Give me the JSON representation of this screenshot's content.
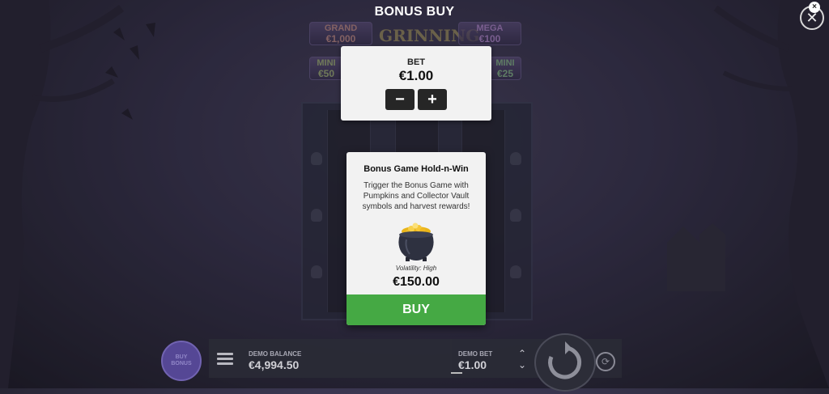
{
  "title": "BONUS BUY",
  "close": {
    "glyph": "✕",
    "badge": "×"
  },
  "game_background": {
    "jackpots": [
      {
        "name": "GRAND",
        "value": "€1,000"
      },
      {
        "name": "MEGA",
        "value": "€100"
      },
      {
        "name": "MINI",
        "value": "€50"
      },
      {
        "name": "MINI",
        "value": "€25"
      }
    ],
    "logo": "GRINNING"
  },
  "bet_panel": {
    "label": "BET",
    "value": "€1.00",
    "minus": "−",
    "plus": "+"
  },
  "bonus_card": {
    "title": "Bonus Game Hold-n-Win",
    "description": "Trigger the Bonus Game with Pumpkins and Collector Vault symbols and harvest rewards!",
    "volatility": "Volatility: High",
    "price": "€150.00",
    "buy_label": "BUY",
    "image_icon": "pot-of-gold-icon"
  },
  "bottom_bar": {
    "buy_bonus_label_1": "BUY",
    "buy_bonus_label_2": "BONUS",
    "balance_label": "DEMO BALANCE",
    "balance_value": "€4,994.50",
    "bet_label": "DEMO BET",
    "bet_value": "€1.00",
    "arrow_up": "⌃",
    "arrow_down": "⌄",
    "autoplay_glyph": "⟳"
  },
  "colors": {
    "buy_green": "#45a944",
    "panel": "#f2f2f2",
    "dark_button": "#262626"
  }
}
